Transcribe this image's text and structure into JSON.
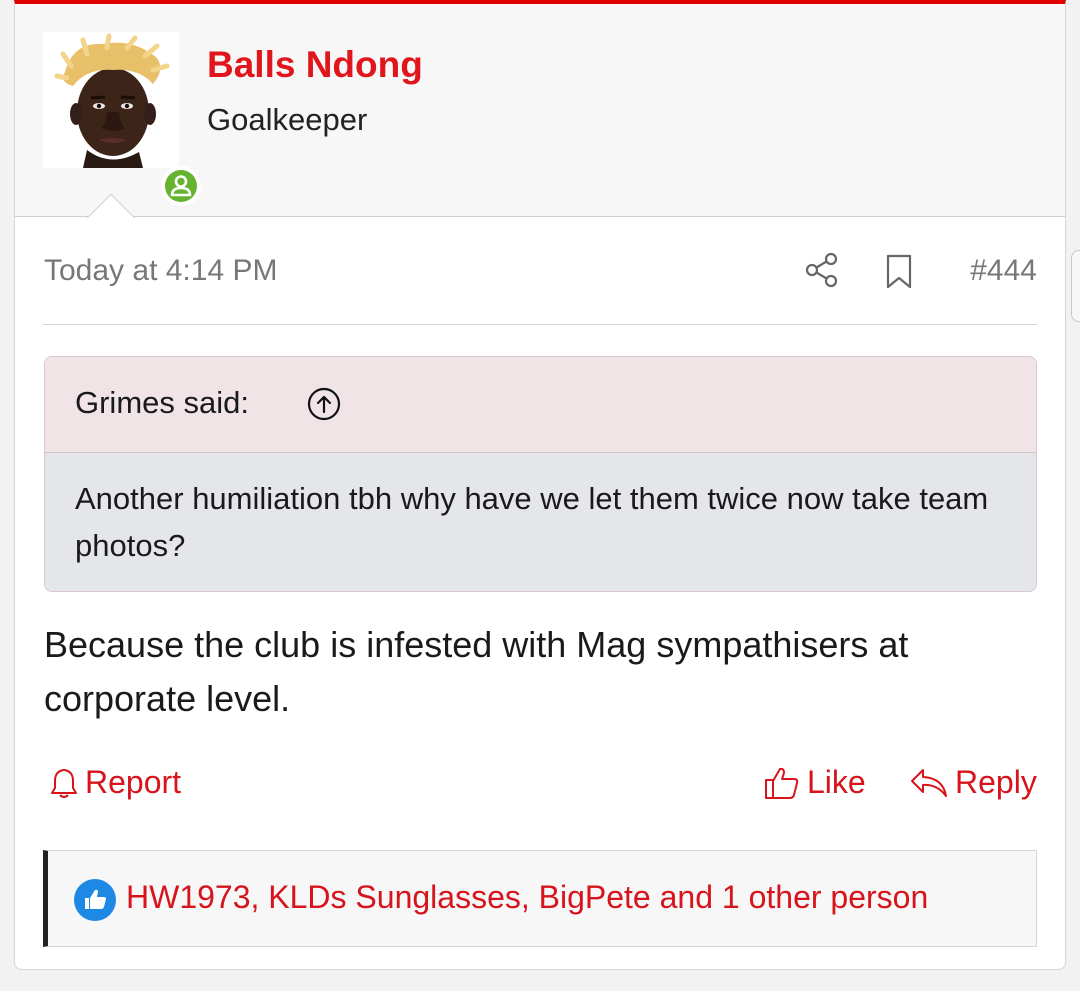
{
  "user": {
    "name": "Balls Ndong",
    "title": "Goalkeeper",
    "status": "online"
  },
  "meta": {
    "date": "Today at 4:14 PM",
    "post_number": "#444",
    "icons": [
      "share-icon",
      "bookmark-icon"
    ]
  },
  "quote": {
    "author": "Grimes said:",
    "text": "Another humiliation tbh why have we let them twice now take team photos?"
  },
  "post": {
    "body": "Because the club is infested with Mag sympathisers at corporate level."
  },
  "actions": {
    "report": "Report",
    "like": "Like",
    "reply": "Reply"
  },
  "reactions": {
    "text": "HW1973, KLDs Sunglasses, BigPete and 1 other person"
  },
  "colors": {
    "accent": "#e0161c",
    "online": "#65b32e",
    "like_badge": "#1e88e5"
  }
}
